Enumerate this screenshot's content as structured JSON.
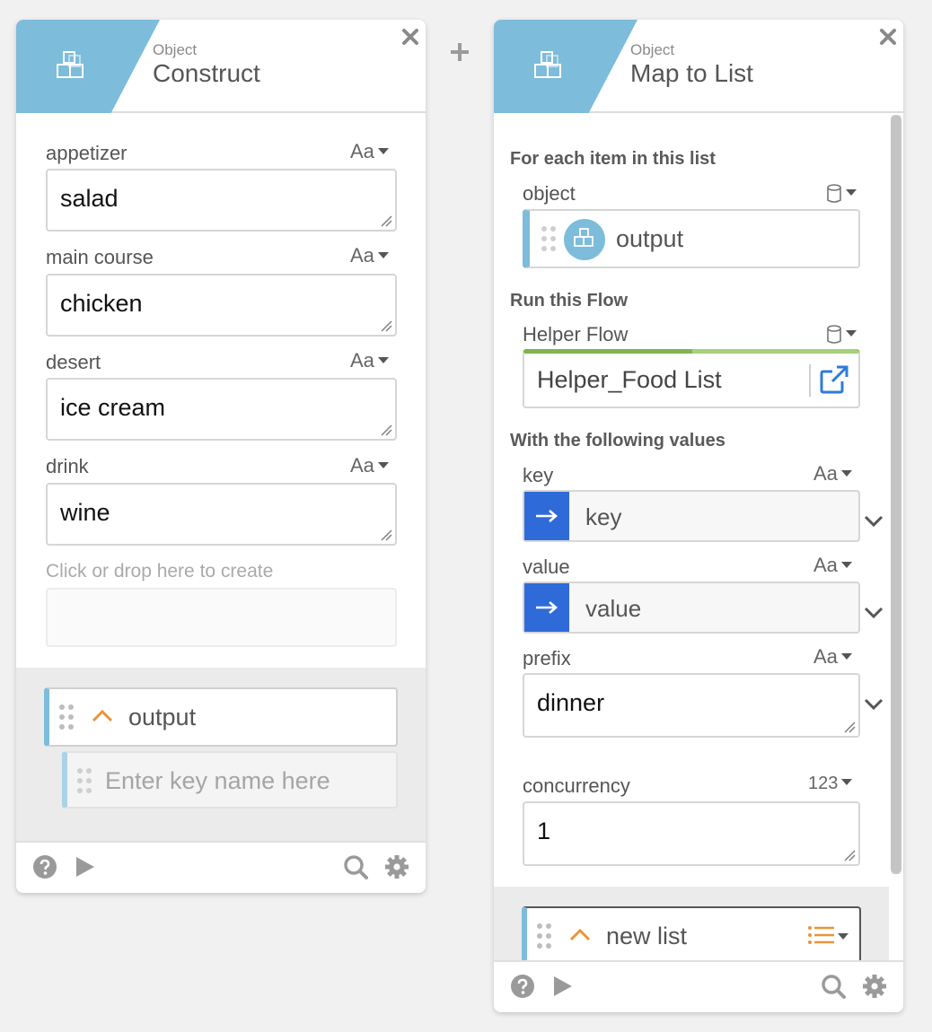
{
  "construct_card": {
    "subtitle": "Object",
    "title": "Construct",
    "fields": [
      {
        "label": "appetizer",
        "type": "Aa",
        "value": "salad"
      },
      {
        "label": "main course",
        "type": "Aa",
        "value": "chicken"
      },
      {
        "label": "desert",
        "type": "Aa",
        "value": "ice cream"
      },
      {
        "label": "drink",
        "type": "Aa",
        "value": "wine"
      }
    ],
    "drop_hint": "Click or drop here to create",
    "output_label": "output",
    "key_placeholder": "Enter key name here"
  },
  "map_card": {
    "subtitle": "Object",
    "title": "Map to List",
    "section_for_each": "For each item in this list",
    "object_label": "object",
    "object_value": "output",
    "section_run_flow": "Run this Flow",
    "helper_flow_label": "Helper Flow",
    "helper_flow_value": "Helper_Food List",
    "section_values": "With the following values",
    "key_label": "key",
    "key_type": "Aa",
    "key_value": "key",
    "value_label": "value",
    "value_type": "Aa",
    "value_value": "value",
    "prefix_label": "prefix",
    "prefix_type": "Aa",
    "prefix_value": "dinner",
    "concurrency_label": "concurrency",
    "concurrency_type": "123",
    "concurrency_value": "1",
    "output_label": "new list"
  },
  "colors": {
    "header_accent": "#7dbcdb",
    "flow_accent": "#7fb44f",
    "mapping_blue": "#2f6bd8",
    "output_caret": "#e8953a",
    "link_icon": "#2f7bd8"
  }
}
